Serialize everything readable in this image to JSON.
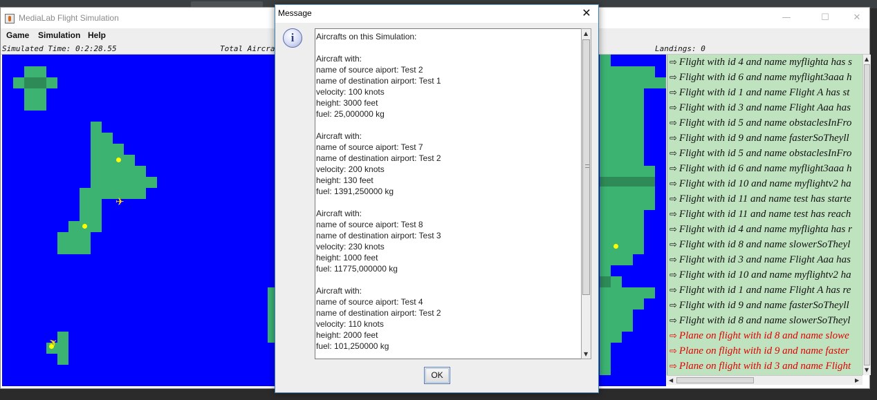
{
  "app": {
    "title": "MediaLab Flight Simulation",
    "window_controls": {
      "minimize": "—",
      "maximize": "☐",
      "close": "✕"
    }
  },
  "menu": {
    "items": [
      "Game",
      "Simulation",
      "Help"
    ]
  },
  "status": {
    "simulated_time": "Simulated Time: 0:2:28.55",
    "total_aircraft": "Total Aircra",
    "landings": "Landings: 0"
  },
  "log": {
    "lines": [
      {
        "text": "Flight with id 4 and name myflighta has s",
        "color": "#111111"
      },
      {
        "text": "Flight with id 6 and name myflight3aaa h",
        "color": "#111111"
      },
      {
        "text": "Flight with id 1 and name Flight A has st",
        "color": "#111111"
      },
      {
        "text": "Flight with id 3 and name Flight Aaa has",
        "color": "#111111"
      },
      {
        "text": "Flight with id 5 and name obstaclesInFro",
        "color": "#111111"
      },
      {
        "text": "Flight with id 9 and name fasterSoTheyll",
        "color": "#111111"
      },
      {
        "text": "Flight with id 5 and name obstaclesInFro",
        "color": "#111111"
      },
      {
        "text": "Flight with id 6 and name myflight3aaa h",
        "color": "#111111"
      },
      {
        "text": "Flight with id 10 and name myflightv2 ha",
        "color": "#111111"
      },
      {
        "text": "Flight with id 11 and name test has starte",
        "color": "#111111"
      },
      {
        "text": "Flight with id 11 and name test has reach",
        "color": "#111111"
      },
      {
        "text": "Flight with id 4 and name myflighta has r",
        "color": "#111111"
      },
      {
        "text": "Flight with id 8 and name slowerSoTheyl",
        "color": "#111111"
      },
      {
        "text": "Flight with id 3 and name Flight Aaa has",
        "color": "#111111"
      },
      {
        "text": "Flight with id 10 and name myflightv2 ha",
        "color": "#111111"
      },
      {
        "text": "Flight with id 1 and name Flight A has re",
        "color": "#111111"
      },
      {
        "text": "Flight with id 9 and name fasterSoTheyll",
        "color": "#111111"
      },
      {
        "text": "Flight with id 8 and name slowerSoTheyl",
        "color": "#111111"
      },
      {
        "text": "Plane on flight with id 8 and name slowe",
        "color": "#e00000"
      },
      {
        "text": "Plane on flight with id 9 and name faster",
        "color": "#e00000"
      },
      {
        "text": "Plane on flight with id 3 and name Flight",
        "color": "#e00000"
      }
    ],
    "arrow_icon": "⇨"
  },
  "dialog": {
    "title": "Message",
    "close": "✕",
    "icon": "i",
    "message": "Aircrafts on this Simulation:\n\nAircraft with:\nname of source aiport: Test 2\nname of destination airport: Test 1\nvelocity: 100 knots\nheight: 3000 feet\nfuel: 25,000000 kg\n\nAircraft with:\nname of source aiport: Test 7\nname of destination airport: Test 2\nvelocity: 200 knots\nheight: 130 feet\nfuel: 1391,250000 kg\n\nAircraft with:\nname of source aiport: Test 8\nname of destination airport: Test 3\nvelocity: 230 knots\nheight: 1000 feet\nfuel: 11775,000000 kg\n\nAircraft with:\nname of source aiport: Test 4\nname of destination airport: Test 2\nvelocity: 110 knots\nheight: 2000 feet\nfuel: 101,250000 kg",
    "ok_label": "OK"
  },
  "colors": {
    "water": "#0000ff",
    "land": "#3cb371",
    "land_dark": "#2e8b57",
    "airport": "#ffff00",
    "log_bg": "#bfe3bf",
    "log_alert": "#e00000"
  }
}
